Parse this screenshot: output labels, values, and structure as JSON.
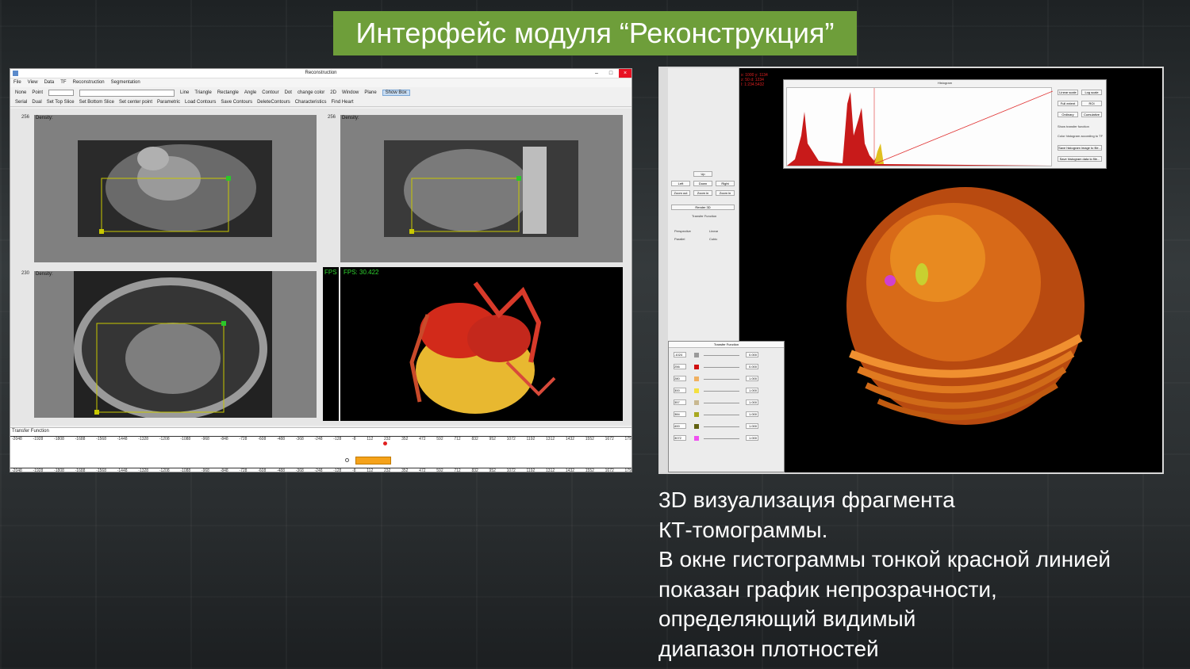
{
  "slide_title": "Интерфейс модуля “Реконструкция”",
  "window": {
    "title": "Reconstruction",
    "menu": [
      "File",
      "View",
      "Data",
      "TF",
      "Reconstruction",
      "Segmentation"
    ],
    "toolbar_left": [
      "None",
      "Point"
    ],
    "toolbar_tools": [
      "Line",
      "Triangle",
      "Rectangle",
      "Angle",
      "Contour",
      "Dot",
      "change color",
      "2D",
      "Window",
      "Plane",
      "Show Box"
    ],
    "toolbar2": [
      "Serial",
      "Dual",
      "Set Top Slice",
      "Set Bottom Slice",
      "Set center point",
      "Parametric",
      "Load Contours",
      "Save Contours",
      "DeleteContours",
      "Characteristics",
      "Find Heart"
    ],
    "views": [
      {
        "label": "Density:",
        "num": "256"
      },
      {
        "label": "Density:",
        "num": "256"
      },
      {
        "label": "Density:",
        "num": "230"
      }
    ],
    "fps_side": "FPS",
    "fps_main": "FPS: 30.422",
    "transfer_function_label": "Transfer Function",
    "ruler_ticks": [
      "-2048",
      "-1928",
      "-1808",
      "-1688",
      "-1568",
      "-1448",
      "-1328",
      "-1208",
      "-1088",
      "-968",
      "-848",
      "-728",
      "-608",
      "-488",
      "-368",
      "-248",
      "-128",
      "-8",
      "112",
      "232",
      "352",
      "472",
      "592",
      "712",
      "832",
      "952",
      "1072",
      "1192",
      "1312",
      "1432",
      "1552",
      "1672",
      "179"
    ]
  },
  "right": {
    "coords": "x: 1000 y: 1134\nz: 50 d: 1234\nI: 1:234.5432",
    "histogram_title": "Histogram",
    "hist_buttons": [
      "Linear scale",
      "Log scale",
      "Full extent",
      "ROI",
      "Ordinary",
      "Cumulative"
    ],
    "hist_checks": [
      "Show transfer function",
      "Color histogram according to TF"
    ],
    "hist_actions": [
      "Save histogram image to file...",
      "Save histogram data to file..."
    ],
    "side_buttons": [
      "Up",
      "Left",
      "Down",
      "Right",
      "Zoom out",
      "Zoom in",
      "Zoom in",
      "Render 3D"
    ],
    "side_labels": [
      "Transfer Function",
      "Perspective",
      "Parallel",
      "Linear",
      "Cubic"
    ],
    "tf_window_title": "Transfer Function",
    "tf_rows": [
      {
        "value": "-1024",
        "color": "#9a9a9a",
        "field": "0.000"
      },
      {
        "value": "256",
        "color": "#d01010",
        "field": "0.000"
      },
      {
        "value": "280",
        "color": "#f0b060",
        "field": "1.000"
      },
      {
        "value": "300",
        "color": "#f4e040",
        "field": "1.000"
      },
      {
        "value": "357",
        "color": "#c8b890",
        "field": "1.000"
      },
      {
        "value": "384",
        "color": "#a8a820",
        "field": "1.000"
      },
      {
        "value": "400",
        "color": "#606010",
        "field": "1.000"
      },
      {
        "value": "3072",
        "color": "#f050f0",
        "field": "1.000"
      }
    ]
  },
  "caption": [
    "3D визуализация фрагмента",
    "КТ-томограммы.",
    "В окне гистограммы тонкой красной линией",
    "показан график непрозрачности,",
    "определяющий видимый",
    "диапазон плотностей"
  ]
}
